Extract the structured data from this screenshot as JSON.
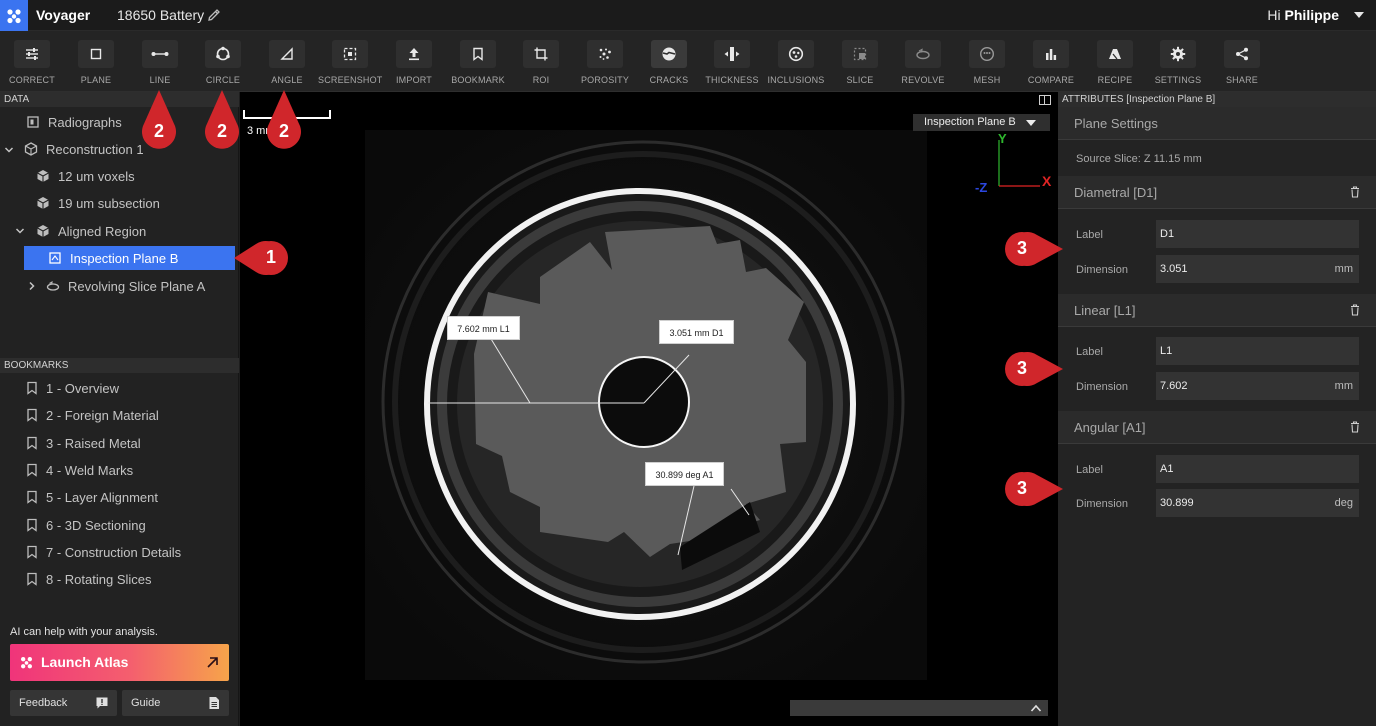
{
  "app": {
    "name": "Voyager",
    "document_title": "18650 Battery",
    "greeting_prefix": "Hi",
    "user_name": "Philippe",
    "accent_color": "#3b74f0"
  },
  "toolbar": {
    "tools": [
      {
        "label": "CORRECT",
        "icon": "sliders-icon"
      },
      {
        "label": "PLANE",
        "icon": "square-icon"
      },
      {
        "label": "LINE",
        "icon": "line-measure-icon"
      },
      {
        "label": "CIRCLE",
        "icon": "circle-measure-icon"
      },
      {
        "label": "ANGLE",
        "icon": "angle-measure-icon"
      },
      {
        "label": "SCREENSHOT",
        "icon": "screenshot-icon"
      },
      {
        "label": "IMPORT",
        "icon": "upload-icon"
      },
      {
        "label": "BOOKMARK",
        "icon": "bookmark-icon"
      },
      {
        "label": "ROI",
        "icon": "crop-icon"
      },
      {
        "label": "POROSITY",
        "icon": "porosity-icon"
      },
      {
        "label": "CRACKS",
        "icon": "cracks-icon"
      },
      {
        "label": "THICKNESS",
        "icon": "thickness-icon"
      },
      {
        "label": "INCLUSIONS",
        "icon": "inclusions-icon"
      },
      {
        "label": "SLICE",
        "icon": "slice-icon"
      },
      {
        "label": "REVOLVE",
        "icon": "revolve-icon"
      },
      {
        "label": "MESH",
        "icon": "mesh-icon"
      },
      {
        "label": "COMPARE",
        "icon": "compare-chart-icon"
      },
      {
        "label": "RECIPE",
        "icon": "recipe-icon"
      },
      {
        "label": "SETTINGS",
        "icon": "gear-icon"
      },
      {
        "label": "SHARE",
        "icon": "share-icon"
      }
    ]
  },
  "data_panel": {
    "title": "DATA",
    "items": [
      {
        "label": "Radiographs",
        "icon": "radiograph-icon"
      },
      {
        "label": "Reconstruction 1",
        "icon": "cube-icon",
        "expanded": true
      },
      {
        "label": "12 um voxels",
        "icon": "cube-icon"
      },
      {
        "label": "19 um subsection",
        "icon": "cube-icon"
      },
      {
        "label": "Aligned Region",
        "icon": "cube-icon",
        "expanded": true
      },
      {
        "label": "Inspection Plane B",
        "icon": "plane-icon",
        "selected": true
      },
      {
        "label": "Revolving Slice Plane A",
        "icon": "revolve-icon",
        "expanded": false
      }
    ]
  },
  "bookmarks": {
    "title": "BOOKMARKS",
    "items": [
      "1 - Overview",
      "2 - Foreign Material",
      "3 - Raised Metal",
      "4 - Weld Marks",
      "5 - Layer Alignment",
      "6 - 3D Sectioning",
      "7 - Construction Details",
      "8 - Rotating Slices"
    ]
  },
  "ai": {
    "prompt": "AI can help with your analysis.",
    "launch_label": "Launch Atlas"
  },
  "footer_buttons": {
    "feedback": "Feedback",
    "guide": "Guide"
  },
  "viewport": {
    "scale_label": "3 mm",
    "plane_dropdown": "Inspection Plane B",
    "axes": {
      "y": "Y",
      "z": "-Z",
      "x": "X"
    },
    "measurements": {
      "line": "7.602 mm L1",
      "circle": "3.051 mm D1",
      "angle": "30.899 deg A1"
    }
  },
  "attributes": {
    "title": "ATTRIBUTES [Inspection Plane B]",
    "plane_settings": "Plane Settings",
    "source_slice": "Source Slice: Z 11.15 mm",
    "groups": [
      {
        "title": "Diametral [D1]",
        "label_caption": "Label",
        "label_value": "D1",
        "dimension_caption": "Dimension",
        "dimension_value": "3.051",
        "unit": "mm"
      },
      {
        "title": "Linear [L1]",
        "label_caption": "Label",
        "label_value": "L1",
        "dimension_caption": "Dimension",
        "dimension_value": "7.602",
        "unit": "mm"
      },
      {
        "title": "Angular [A1]",
        "label_caption": "Label",
        "label_value": "A1",
        "dimension_caption": "Dimension",
        "dimension_value": "30.899",
        "unit": "deg"
      }
    ]
  },
  "callouts": {
    "one": "1",
    "two": "2",
    "three": "3",
    "color": "#d0262b"
  }
}
